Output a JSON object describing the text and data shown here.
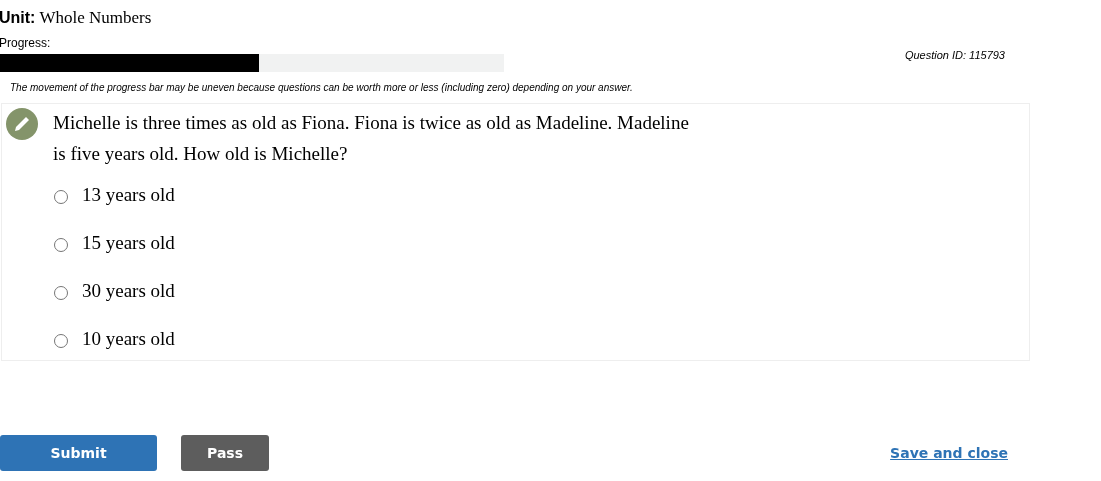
{
  "unit": {
    "label": "Unit:",
    "name": "Whole Numbers"
  },
  "progress": {
    "label": "Progress:",
    "level": 0.514,
    "note": "The movement of the progress bar may be uneven because questions can be worth more or less (including zero) depending on your answer."
  },
  "question_id": "Question ID: 115793",
  "question": {
    "text": "Michelle is three times as old as Fiona. Fiona is twice as old as Madeline. Madeline is five years old. How old is Michelle?",
    "options": [
      {
        "label": "13 years old",
        "selected": false
      },
      {
        "label": "15 years old",
        "selected": false
      },
      {
        "label": "30 years old",
        "selected": false
      },
      {
        "label": "10 years old",
        "selected": false
      }
    ]
  },
  "buttons": [
    {
      "label": "Submit",
      "kind": "primary"
    },
    {
      "label": "Pass",
      "kind": "secondary"
    },
    {
      "label": "Save and close",
      "kind": "link"
    }
  ]
}
